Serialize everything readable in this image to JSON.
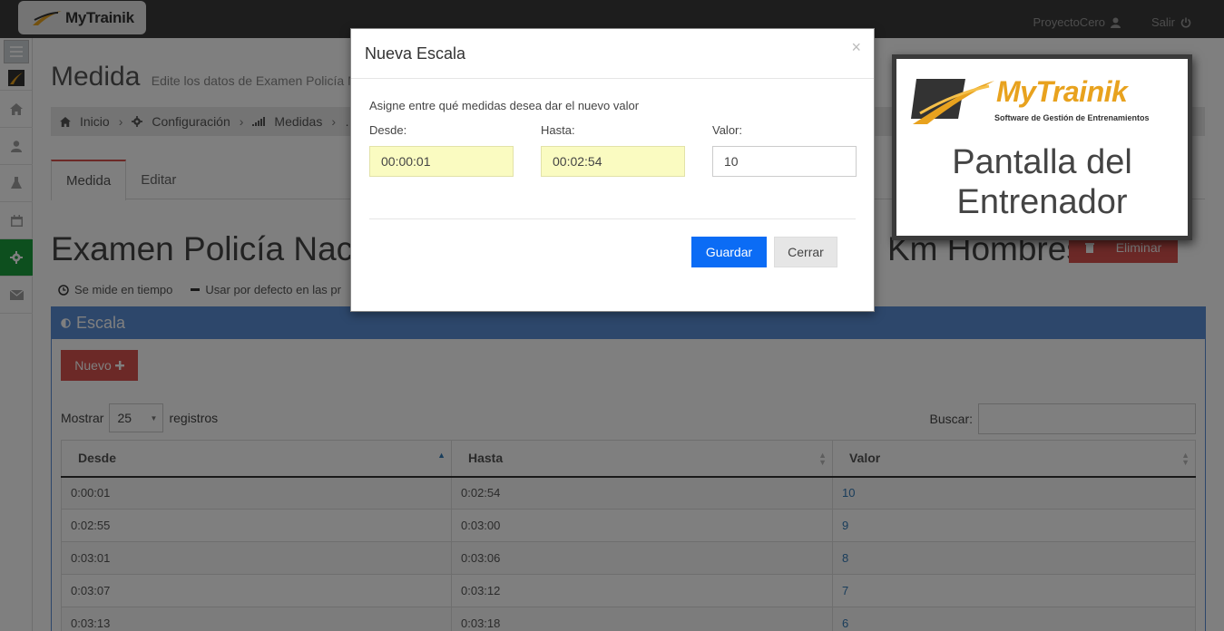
{
  "topbar": {
    "brand": "MyTrainik",
    "user": "ProyectoCero",
    "logout": "Salir"
  },
  "page": {
    "title": "Medida",
    "subtitle": "Edite los datos de Examen Policía N",
    "breadcrumb": [
      "Inicio",
      "Configuración",
      "Medidas",
      "…"
    ],
    "tabs": [
      "Medida",
      "Editar"
    ],
    "exam_title_left": "Examen Policía Naci",
    "exam_title_right": "Km Hombres",
    "delete_label": "Eliminar",
    "meta": {
      "timed": "Se mide en tiempo",
      "default": "Usar por defecto en las pr"
    }
  },
  "panel": {
    "title": "Escala",
    "new_label": "Nuevo",
    "show_label": "Mostrar",
    "page_size": "25",
    "records_label": "registros",
    "search_label": "Buscar:",
    "columns": [
      "Desde",
      "Hasta",
      "Valor"
    ],
    "rows": [
      {
        "desde": "0:00:01",
        "hasta": "0:02:54",
        "valor": "10"
      },
      {
        "desde": "0:02:55",
        "hasta": "0:03:00",
        "valor": "9"
      },
      {
        "desde": "0:03:01",
        "hasta": "0:03:06",
        "valor": "8"
      },
      {
        "desde": "0:03:07",
        "hasta": "0:03:12",
        "valor": "7"
      },
      {
        "desde": "0:03:13",
        "hasta": "0:03:18",
        "valor": "6"
      }
    ]
  },
  "modal": {
    "title": "Nueva Escala",
    "close": "×",
    "description": "Asigne entre qué medidas desea dar el nuevo valor",
    "desde_label": "Desde:",
    "desde_value": "00:00:01",
    "hasta_label": "Hasta:",
    "hasta_value": "00:02:54",
    "valor_label": "Valor:",
    "valor_value": "10",
    "save_label": "Guardar",
    "cancel_label": "Cerrar"
  },
  "badge": {
    "brand": "MyTrainik",
    "tagline": "Software de Gestión de Entrenamientos",
    "caption_line1": "Pantalla del",
    "caption_line2": "Entrenador"
  },
  "colors": {
    "accent_red": "#d9534f",
    "panel_blue": "#5b8fd6",
    "primary_blue": "#0b6cf5",
    "active_green": "#1a9e3d",
    "brand_orange": "#e8a21e"
  }
}
